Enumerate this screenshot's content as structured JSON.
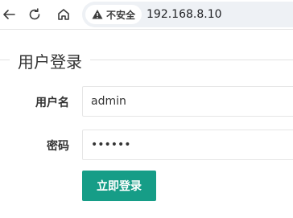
{
  "browser": {
    "security_label": "不安全",
    "url": "192.168.8.10"
  },
  "form": {
    "legend": "用户登录",
    "username_label": "用户名",
    "username_value": "admin",
    "password_label": "密码",
    "password_value": "••••••",
    "submit_label": "立即登录"
  },
  "colors": {
    "button": "#169d87",
    "border": "#e6e6e6"
  }
}
